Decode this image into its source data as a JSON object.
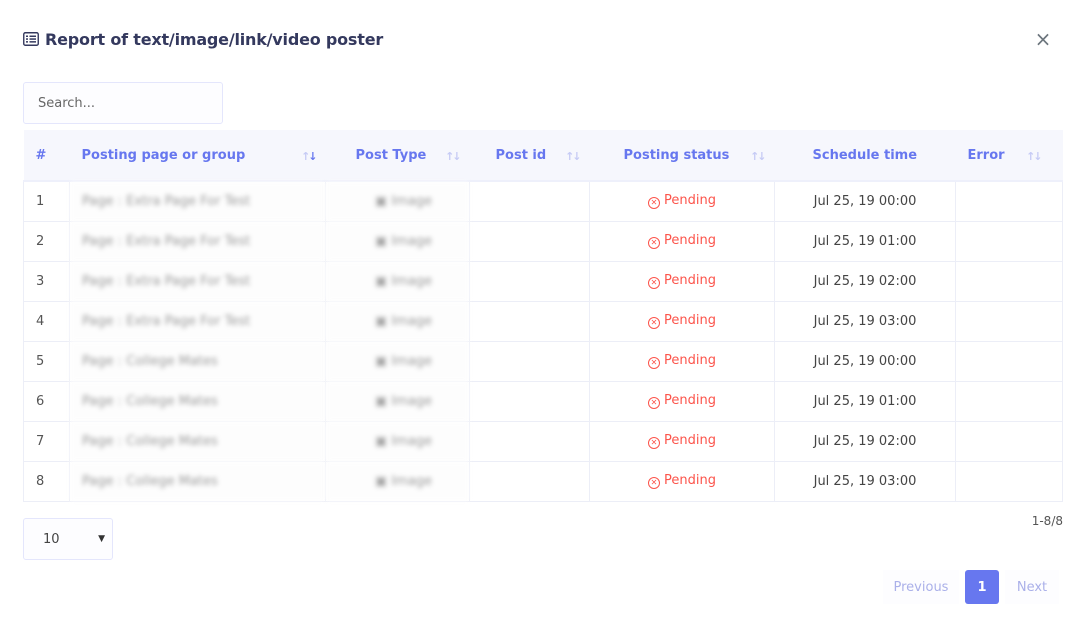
{
  "modal": {
    "title": "Report of text/image/link/video poster",
    "close_label": "×"
  },
  "search": {
    "placeholder": "Search..."
  },
  "table": {
    "headers": [
      "#",
      "Posting page or group",
      "Post Type",
      "Post id",
      "Posting status",
      "Schedule time",
      "Error"
    ],
    "rows": [
      {
        "num": "1",
        "page": "Page : Extra Page For Test",
        "type": "Image",
        "post_id": "",
        "status": "Pending",
        "time": "Jul 25, 19 00:00",
        "error": ""
      },
      {
        "num": "2",
        "page": "Page : Extra Page For Test",
        "type": "Image",
        "post_id": "",
        "status": "Pending",
        "time": "Jul 25, 19 01:00",
        "error": ""
      },
      {
        "num": "3",
        "page": "Page : Extra Page For Test",
        "type": "Image",
        "post_id": "",
        "status": "Pending",
        "time": "Jul 25, 19 02:00",
        "error": ""
      },
      {
        "num": "4",
        "page": "Page : Extra Page For Test",
        "type": "Image",
        "post_id": "",
        "status": "Pending",
        "time": "Jul 25, 19 03:00",
        "error": ""
      },
      {
        "num": "5",
        "page": "Page : College Mates",
        "type": "Image",
        "post_id": "",
        "status": "Pending",
        "time": "Jul 25, 19 00:00",
        "error": ""
      },
      {
        "num": "6",
        "page": "Page : College Mates",
        "type": "Image",
        "post_id": "",
        "status": "Pending",
        "time": "Jul 25, 19 01:00",
        "error": ""
      },
      {
        "num": "7",
        "page": "Page : College Mates",
        "type": "Image",
        "post_id": "",
        "status": "Pending",
        "time": "Jul 25, 19 02:00",
        "error": ""
      },
      {
        "num": "8",
        "page": "Page : College Mates",
        "type": "Image",
        "post_id": "",
        "status": "Pending",
        "time": "Jul 25, 19 03:00",
        "error": ""
      }
    ]
  },
  "footer": {
    "count": "1-8/8",
    "per_page": "10",
    "pagination": {
      "prev": "Previous",
      "current": "1",
      "next": "Next"
    }
  },
  "colors": {
    "accent": "#6777ef",
    "danger": "#fc544b"
  },
  "icons": {
    "title": "list-icon",
    "status": "x-circle-icon",
    "post_type": "image-icon"
  }
}
